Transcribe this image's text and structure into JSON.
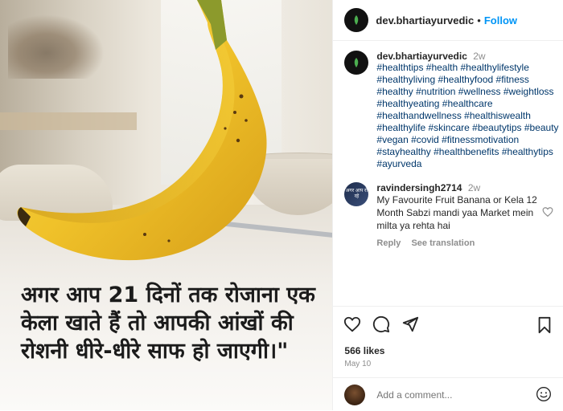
{
  "post": {
    "username": "dev.bhartiayurvedic",
    "follow_label": "Follow",
    "separator": "•",
    "overlay_text": "अगर आप 21 दिनों तक रोजाना एक केला खाते हैं तो आपकी आंखों की रोशनी धीरे-धीरे साफ हो जाएगी।\""
  },
  "caption": {
    "username": "dev.bhartiayurvedic",
    "time": "2w",
    "hashtags": "#healthtips #health #healthylifestyle #healthyliving #healthyfood #fitness #healthy #nutrition #wellness #weightloss #healthyeating #healthcare #healthandwellness #healthiswealth #healthylife #skincare #beautytips #beauty #vegan #covid #fitnessmotivation #stayhealthy #healthbenefits #healthytips #ayurveda"
  },
  "comment": {
    "username": "ravindersingh2714",
    "time": "2w",
    "text": "My Favourite Fruit Banana or Kela 12 Month Sabzi mandi yaa Market mein milta ya rehta hai",
    "reply_label": "Reply",
    "translate_label": "See translation",
    "avatar_text": "अगर आप रो रहे"
  },
  "stats": {
    "likes": "566 likes",
    "date": "May 10"
  },
  "add_comment": {
    "placeholder": "Add a comment..."
  },
  "icons": {
    "like": "heart-icon",
    "comment": "comment-icon",
    "share": "share-icon",
    "save": "bookmark-icon",
    "emoji": "emoji-icon"
  },
  "colors": {
    "follow": "#0095f6",
    "hashtag": "#00376b",
    "muted": "#8e8e8e",
    "banana": "#f2c52b"
  }
}
